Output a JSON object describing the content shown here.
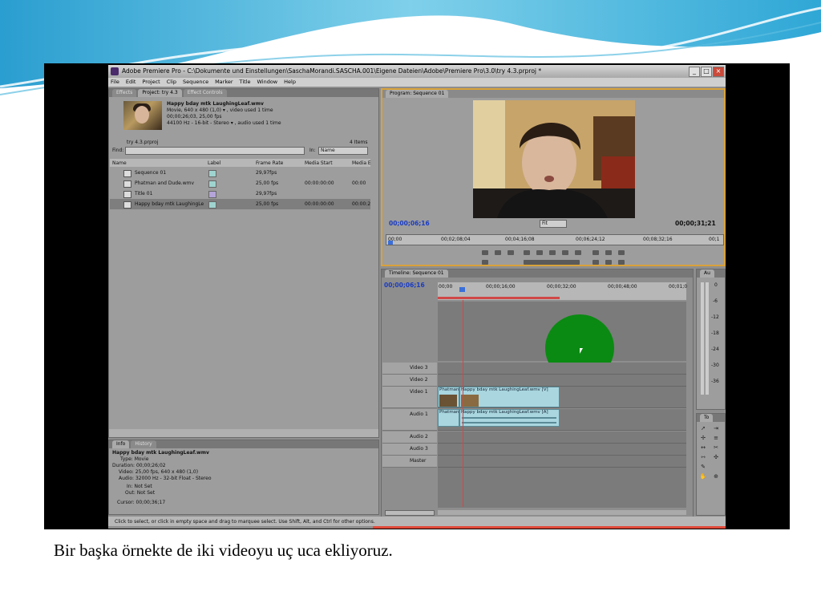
{
  "window": {
    "title": "Adobe Premiere Pro - C:\\Dokumente und Einstellungen\\SaschaMorandi.SASCHA.001\\Eigene Dateien\\Adobe\\Premiere Pro\\3.0\\try 4.3.prproj *"
  },
  "menu": [
    "File",
    "Edit",
    "Project",
    "Clip",
    "Sequence",
    "Marker",
    "Title",
    "Window",
    "Help"
  ],
  "project_panel": {
    "tabs": [
      "Effects",
      "Project: try 4.3",
      "Effect Controls"
    ],
    "clip_name": "Happy bday mtk LaughingLeaf.wmv",
    "clip_info": [
      "Movie, 640 x 480 (1,0)  ▾ , video used 1 time",
      "00;00;26;03, 25,00 fps",
      "44100 Hz - 16-bit - Stereo  ▾ , audio used 1 time"
    ],
    "project_file": "try 4.3.prproj",
    "item_count": "4 Items",
    "find_label": "Find:",
    "in_label": "In:",
    "in_value": "Name",
    "columns": [
      "Name",
      "Label",
      "Frame Rate",
      "Media Start",
      "Media E"
    ],
    "items": [
      {
        "name": "Sequence 01",
        "label_color": "#9fd3cf",
        "frame_rate": "29,97fps",
        "media_start": "",
        "media_end": ""
      },
      {
        "name": "Phatman and Dude.wmv",
        "label_color": "#9fd3cf",
        "frame_rate": "25,00 fps",
        "media_start": "00:00:00:00",
        "media_end": "00:00"
      },
      {
        "name": "Title 01",
        "label_color": "#b4a4d8",
        "frame_rate": "29,97fps",
        "media_start": "",
        "media_end": ""
      },
      {
        "name": "Happy bday mtk LaughingLe",
        "label_color": "#9fd3cf",
        "frame_rate": "25,00 fps",
        "media_start": "00:00:00:00",
        "media_end": "00:00:2"
      }
    ]
  },
  "info_panel": {
    "tabs": [
      "Info",
      "History"
    ],
    "lines": [
      "Happy bday mtk LaughingLeaf.wmv",
      "Type: Movie",
      "Duration: 00;00;26;02",
      "Video: 25,00 fps, 640 x 480 (1,0)",
      "Audio: 32000 Hz - 32-bit Float - Stereo",
      "In: Not Set",
      "Out: Not Set",
      "Cursor: 00;00;36;17"
    ]
  },
  "program_monitor": {
    "tab": "Program: Sequence 01",
    "current_time": "00;00;06;16",
    "duration": "00;00;31;21",
    "fit_label": "Fit",
    "ruler_ticks": [
      "00;00",
      "00;02;08;04",
      "00;04;16;08",
      "00;06;24;12",
      "00;08;32;16",
      "00;1"
    ]
  },
  "timeline": {
    "tab": "Timeline: Sequence 01",
    "current_time": "00;00;06;16",
    "ruler_ticks": [
      "00;00",
      "00;00;16;00",
      "00;00;32;00",
      "00;00;48;00",
      "00;01;0"
    ],
    "tracks": [
      {
        "name": "Video 3"
      },
      {
        "name": "Video 2"
      },
      {
        "name": "Video 1"
      },
      {
        "name": "Audio 1"
      },
      {
        "name": "Audio 2"
      },
      {
        "name": "Audio 3"
      },
      {
        "name": "Master"
      }
    ],
    "video_clips": [
      "Phatman",
      "Happy bday mtk LaughingLeaf.wmv [V]"
    ],
    "audio_clips": [
      "Phatman",
      "Happy bday mtk LaughingLeaf.wmv [A]"
    ]
  },
  "audio_meter": {
    "label": "Au",
    "db_ticks": [
      "0",
      "-6",
      "-12",
      "-18",
      "-24",
      "-30",
      "-36"
    ]
  },
  "tools": {
    "label": "To"
  },
  "status_bar": "Click to select, or click in empty space and drag to marquee select. Use Shift, Alt, and Ctrl for other options.",
  "caption": "Bir başka örnekte de iki videoyu uç uca ekliyoruz.",
  "colors": {
    "highlight_circle": "#0a8a12",
    "monitor_border": "#d9a23a",
    "clip": "#a9d6df",
    "sky_wave": "#3aa9d4"
  }
}
